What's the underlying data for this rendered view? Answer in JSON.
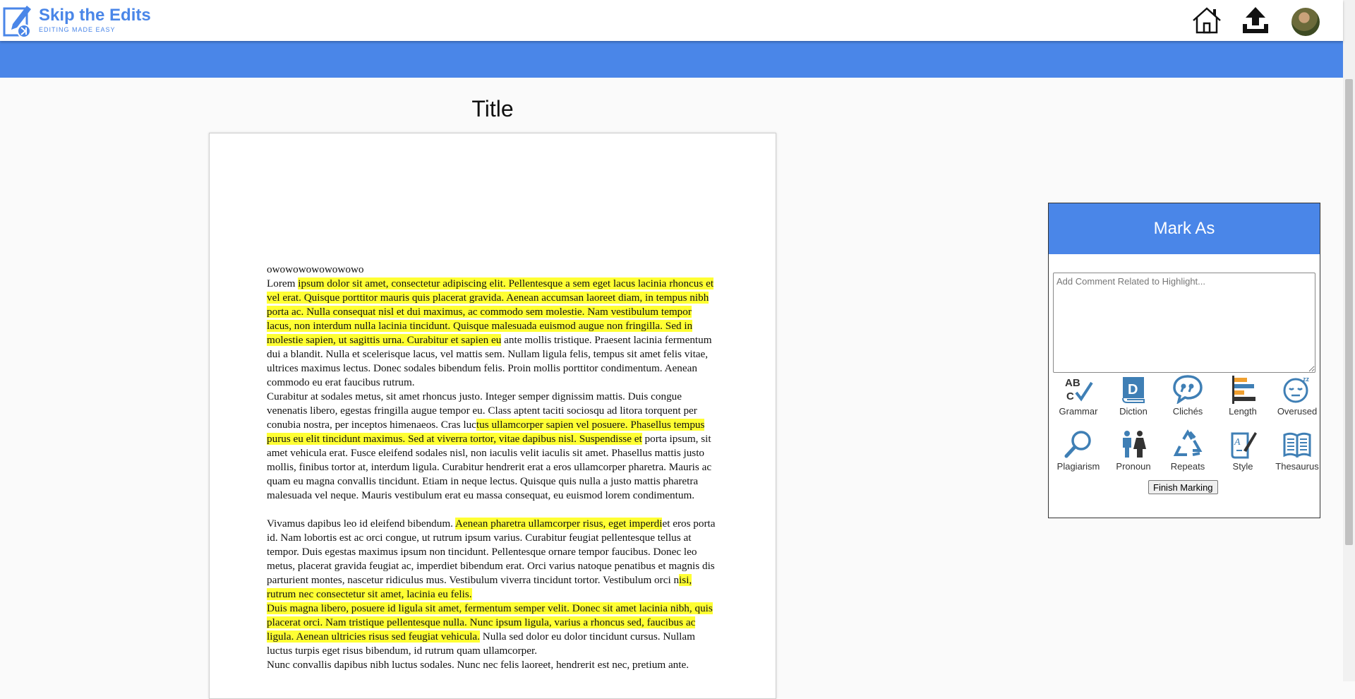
{
  "brand": {
    "name": "Skip the Edits",
    "tagline": "EDITING MADE EASY"
  },
  "document": {
    "title": "Title",
    "paragraphs": [
      [
        {
          "t": "owowowowowowowo"
        }
      ],
      [
        {
          "t": "Lorem "
        },
        {
          "t": "ipsum dolor sit amet, consectetur adipiscing elit. Pellentesque a sem eget lacus lacinia rhoncus et vel erat. Quisque porttitor mauris quis placerat gravida. Aenean accumsan laoreet diam, in tempus nibh porta ac. Nulla consequat nisl et dui maximus, ac commodo sem molestie. Nam vestibulum tempor lacus, non interdum nulla lacinia tincidunt. Quisque malesuada euismod augue non fringilla. Sed in molestie sapien, ut sagittis urna. Curabitur et sapien eu",
          "h": true
        },
        {
          "t": " ante mollis tristique. Praesent lacinia fermentum dui a blandit. Nulla et scelerisque lacus, vel mattis sem. Nullam ligula felis, tempus sit amet felis vitae, ultrices maximus lectus. Donec sodales bibendum felis. Proin mollis porttitor condimentum. Aenean commodo eu erat faucibus rutrum."
        }
      ],
      [
        {
          "t": "Curabitur at sodales metus, sit amet rhoncus justo. Integer semper dignissim mattis. Duis congue venenatis libero, egestas fringilla augue tempor eu. Class aptent taciti sociosqu ad litora torquent per conubia nostra, per inceptos himenaeos. Cras luc"
        },
        {
          "t": "tus ullamcorper sapien vel posuere. Phasellus tempus purus eu elit tincidunt maximus. Sed at viverra tortor, vitae dapibus nisl. Suspendisse et",
          "h": true
        },
        {
          "t": " porta ipsum, sit amet vehicula erat. Fusce eleifend sodales nisl, non iaculis velit iaculis sit amet. Phasellus mattis justo mollis, finibus tortor at, interdum ligula. Curabitur hendrerit erat a eros ullamcorper pharetra. Mauris ac quam eu magna convallis tincidunt. Etiam in neque lectus. Quisque quis nulla a justo mattis pharetra malesuada vel neque. Mauris vestibulum erat eu massa consequat, eu euismod lorem condimentum."
        }
      ],
      [
        {
          "t": " "
        }
      ],
      [
        {
          "t": "Vivamus dapibus leo id eleifend bibendum. "
        },
        {
          "t": "Aenean pharetra ullamcorper risus, eget imperdi",
          "h": true
        },
        {
          "t": "et eros porta id. Nam lobortis est ac orci congue, ut rutrum ipsum varius. Curabitur feugiat pellentesque tellus at tempor. Duis egestas maximus ipsum non tincidunt. Pellentesque ornare tempor faucibus. Donec leo metus, placerat gravida feugiat ac, imperdiet bibendum erat. Orci varius natoque penatibus et magnis dis parturient montes, nascetur ridiculus mus. Vestibulum viverra tincidunt tortor. Vestibulum orci n"
        },
        {
          "t": "isi, rutrum nec consectetur sit amet, lacinia eu felis.",
          "h": true
        }
      ],
      [
        {
          "t": "Duis magna libero, posuere id ligula sit amet, fermentum semper velit. Donec sit amet lacinia nibh, quis placerat orci. Nam tristique pellentesque nulla. Nunc ipsum ligula, varius a rhoncus sed, faucibus ac ligula. Aenean ultricies risus sed feugiat vehicula.",
          "h": true
        },
        {
          "t": " Nulla sed dolor eu dolor tincidunt cursus. Nullam luctus turpis eget risus bibendum, id rutrum quam ullamcorper."
        }
      ],
      [
        {
          "t": "Nunc convallis dapibus nibh luctus sodales. Nunc nec felis laoreet, hendrerit est nec, pretium ante."
        }
      ]
    ]
  },
  "panel": {
    "title": "Mark As",
    "comment_placeholder": "Add Comment Related to Highlight...",
    "tools": [
      {
        "label": "Grammar",
        "icon": "grammar-icon"
      },
      {
        "label": "Diction",
        "icon": "diction-icon"
      },
      {
        "label": "Clichés",
        "icon": "cliches-icon"
      },
      {
        "label": "Length",
        "icon": "length-icon"
      },
      {
        "label": "Overused",
        "icon": "overused-icon"
      },
      {
        "label": "Plagiarism",
        "icon": "plagiarism-icon"
      },
      {
        "label": "Pronoun",
        "icon": "pronoun-icon"
      },
      {
        "label": "Repeats",
        "icon": "repeats-icon"
      },
      {
        "label": "Style",
        "icon": "style-icon"
      },
      {
        "label": "Thesaurus",
        "icon": "thesaurus-icon"
      }
    ],
    "finish_label": "Finish Marking"
  },
  "colors": {
    "brand_blue": "#4a86e8",
    "highlight": "#ffff33",
    "icon_blue": "#3f7fb5",
    "icon_orange": "#f0a030"
  }
}
